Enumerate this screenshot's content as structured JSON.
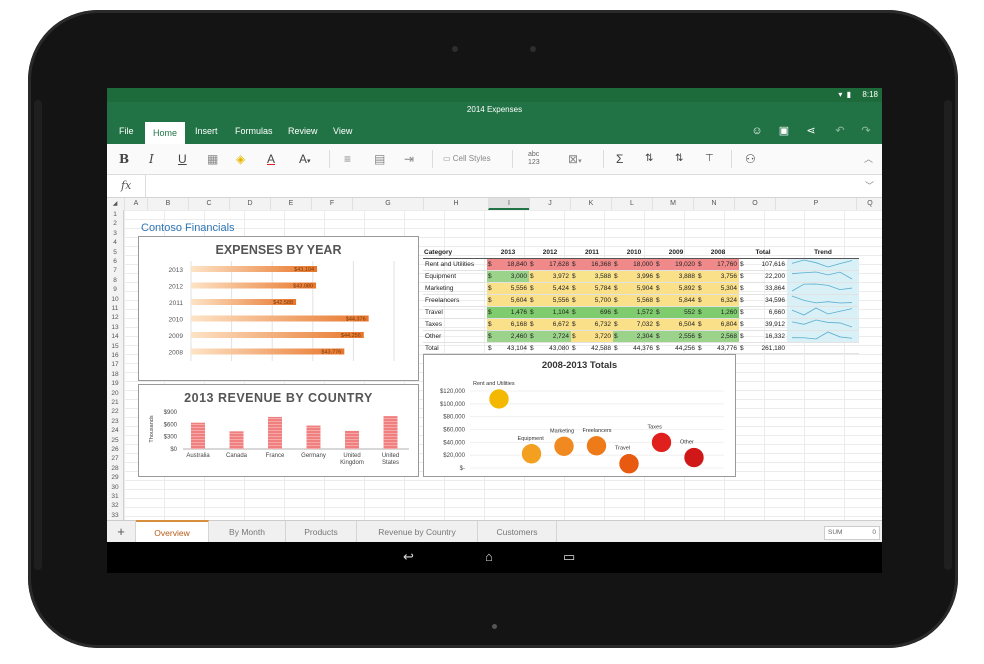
{
  "statusbar": {
    "time": "8:18"
  },
  "window": {
    "title": "2014 Expenses"
  },
  "ribbon": {
    "tabs": [
      "File",
      "Home",
      "Insert",
      "Formulas",
      "Review",
      "View"
    ],
    "active_tab": "Home"
  },
  "toolbar": {
    "cell_styles": "Cell Styles"
  },
  "sheet": {
    "columns": [
      "A",
      "B",
      "C",
      "D",
      "E",
      "F",
      "G",
      "H",
      "I",
      "J",
      "K",
      "L",
      "M",
      "N",
      "O",
      "P",
      "Q"
    ],
    "rows": [
      "1",
      "2",
      "3",
      "4",
      "5",
      "6",
      "7",
      "8",
      "9",
      "10",
      "11",
      "12",
      "13",
      "14",
      "15",
      "16",
      "17",
      "18",
      "19",
      "20",
      "21",
      "22",
      "23",
      "24",
      "25",
      "26",
      "27",
      "28",
      "29",
      "30",
      "31",
      "32",
      "33"
    ],
    "heading": "Contoso Financials"
  },
  "expenses_chart": {
    "chart_data": {
      "type": "bar",
      "title": "EXPENSES BY YEAR",
      "categories": [
        "2013",
        "2012",
        "2011",
        "2010",
        "2009",
        "2008"
      ],
      "values": [
        43104,
        43080,
        42588,
        44376,
        44256,
        43776
      ],
      "value_labels": [
        "$43,104",
        "$43,080",
        "$42,588",
        "$44,376",
        "$44,256",
        "$43,776"
      ],
      "accent": "#e8762b"
    }
  },
  "revenue_chart": {
    "chart_data": {
      "type": "bar",
      "title": "2013 REVENUE BY COUNTRY",
      "ylabel": "Thousands",
      "yticks": [
        "$900",
        "$600",
        "$300",
        "$0"
      ],
      "ylim": [
        0,
        900
      ],
      "categories": [
        "Australia",
        "Canada",
        "France",
        "Germany",
        "United Kingdom",
        "United States"
      ],
      "values": [
        640,
        430,
        780,
        570,
        440,
        800
      ],
      "color": "#f08080"
    }
  },
  "totals_chart": {
    "chart_data": {
      "type": "scatter",
      "title": "2008-2013 Totals",
      "yticks": [
        "$120,000",
        "$100,000",
        "$80,000",
        "$60,000",
        "$40,000",
        "$20,000",
        "$-"
      ],
      "ylim": [
        0,
        120000
      ],
      "points": [
        {
          "label": "Rent and Utilities",
          "y": 107616,
          "color": "#f5b800"
        },
        {
          "label": "Equipment",
          "y": 22200,
          "color": "#f3a020"
        },
        {
          "label": "Marketing",
          "y": 33864,
          "color": "#f08a20"
        },
        {
          "label": "Freelancers",
          "y": 34596,
          "color": "#ee7a18"
        },
        {
          "label": "Travel",
          "y": 6660,
          "color": "#e85a10"
        },
        {
          "label": "Taxes",
          "y": 39912,
          "color": "#e0201c"
        },
        {
          "label": "Other",
          "y": 16332,
          "color": "#d01818"
        }
      ]
    }
  },
  "table": {
    "headers": [
      "Category",
      "2013",
      "2012",
      "2011",
      "2010",
      "2009",
      "2008",
      "Total",
      "Trend"
    ],
    "currency": "$",
    "rows": [
      {
        "category": "Rent and Utilities",
        "values": [
          "18,840",
          "17,628",
          "16,368",
          "18,000",
          "19,020",
          "17,760"
        ],
        "total": "107,616",
        "colors": [
          "#f08a8a",
          "#f08a8a",
          "#f08a8a",
          "#f08a8a",
          "#f08a8a",
          "#f08a8a"
        ]
      },
      {
        "category": "Equipment",
        "values": [
          "3,000",
          "3,972",
          "3,588",
          "3,996",
          "3,888",
          "3,756"
        ],
        "total": "22,200",
        "colors": [
          "#9bd38a",
          "#fbe08a",
          "#f8e48a",
          "#fbe08a",
          "#fbe08a",
          "#fbe08a"
        ]
      },
      {
        "category": "Marketing",
        "values": [
          "5,556",
          "5,424",
          "5,784",
          "5,904",
          "5,892",
          "5,304"
        ],
        "total": "33,864",
        "colors": [
          "#fbe08a",
          "#fbe08a",
          "#fbe08a",
          "#fbe08a",
          "#fbe08a",
          "#fbe08a"
        ]
      },
      {
        "category": "Freelancers",
        "values": [
          "5,604",
          "5,556",
          "5,700",
          "5,568",
          "5,844",
          "6,324"
        ],
        "total": "34,596",
        "colors": [
          "#fbe08a",
          "#fbe08a",
          "#fbe08a",
          "#fbe08a",
          "#fbe08a",
          "#fbe08a"
        ]
      },
      {
        "category": "Travel",
        "values": [
          "1,476",
          "1,104",
          "696",
          "1,572",
          "552",
          "1,260"
        ],
        "total": "6,660",
        "colors": [
          "#7fcc6e",
          "#7fcc6e",
          "#7fcc6e",
          "#7fcc6e",
          "#7fcc6e",
          "#7fcc6e"
        ]
      },
      {
        "category": "Taxes",
        "values": [
          "6,168",
          "6,672",
          "6,732",
          "7,032",
          "6,504",
          "6,804"
        ],
        "total": "39,912",
        "colors": [
          "#fbe08a",
          "#fbe08a",
          "#fbe08a",
          "#fbe08a",
          "#fbe08a",
          "#fbe08a"
        ]
      },
      {
        "category": "Other",
        "values": [
          "2,460",
          "2,724",
          "3,720",
          "2,304",
          "2,556",
          "2,568"
        ],
        "total": "16,332",
        "colors": [
          "#9bd38a",
          "#9bd38a",
          "#fbe08a",
          "#9bd38a",
          "#9bd38a",
          "#9bd38a"
        ]
      }
    ],
    "total_row": {
      "category": "Total",
      "values": [
        "43,104",
        "43,080",
        "42,588",
        "44,376",
        "44,256",
        "43,776"
      ],
      "total": "261,180"
    }
  },
  "sheet_tabs": {
    "add_label": "+",
    "tabs": [
      "Overview",
      "By Month",
      "Products",
      "Revenue by Country",
      "Customers"
    ],
    "active": "Overview",
    "sum_label": "SUM",
    "sum_value": "0"
  }
}
